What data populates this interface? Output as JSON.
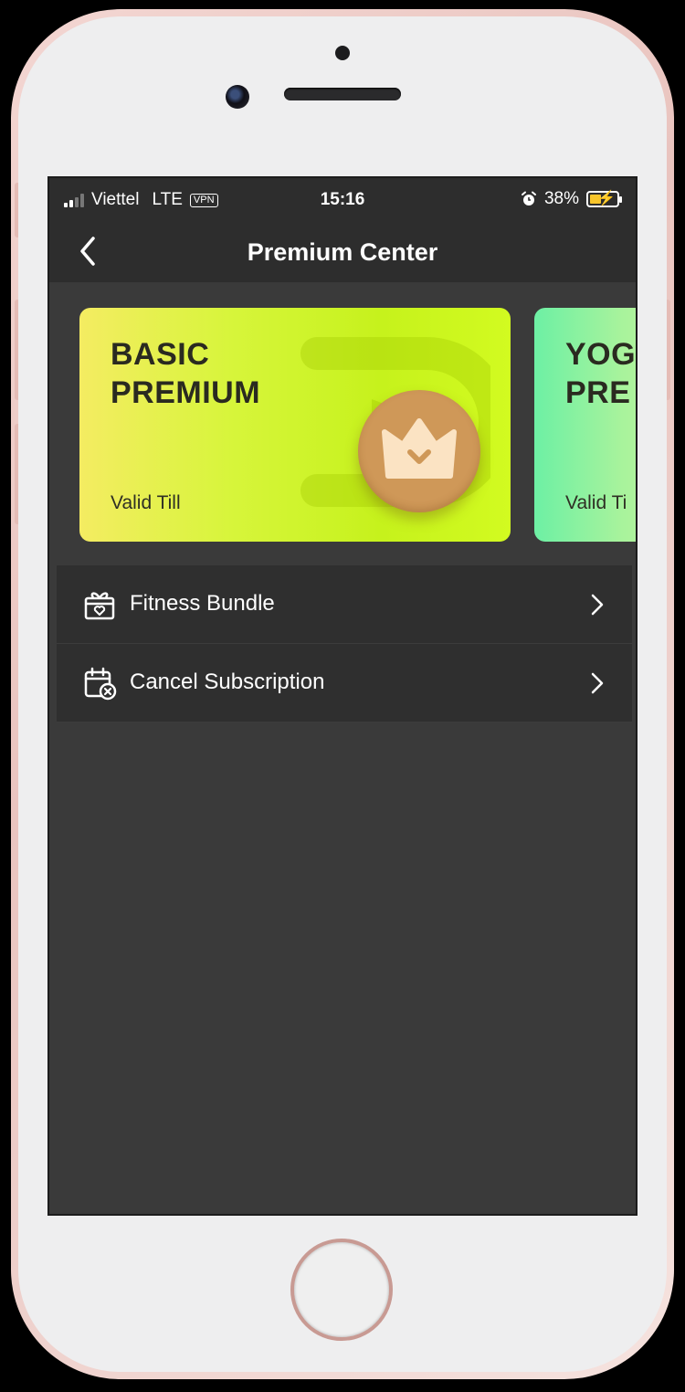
{
  "status_bar": {
    "carrier": "Viettel",
    "network": "LTE",
    "vpn": "VPN",
    "time": "15:16",
    "battery_percent": "38%",
    "battery_level": 0.38,
    "icons": [
      "signal-icon",
      "alarm-icon",
      "battery-charging-icon"
    ]
  },
  "header": {
    "title": "Premium Center",
    "back_icon": "chevron-left-icon"
  },
  "cards": [
    {
      "title_line1": "BASIC",
      "title_line2": "PREMIUM",
      "valid_label": "Valid Till",
      "icon": "crown-icon"
    },
    {
      "title_line1": "YOG",
      "title_line2": "PRE",
      "valid_label": "Valid Ti"
    }
  ],
  "menu": [
    {
      "label": "Fitness Bundle",
      "icon": "gift-box-icon"
    },
    {
      "label": "Cancel Subscription",
      "icon": "calendar-cancel-icon"
    }
  ],
  "colors": {
    "screen_bg": "#3a3a3a",
    "bar_bg": "#2d2d2d",
    "basic_card": "#c6f21c",
    "yoga_card": "#6df0a4",
    "crown_badge": "#cf9858"
  }
}
